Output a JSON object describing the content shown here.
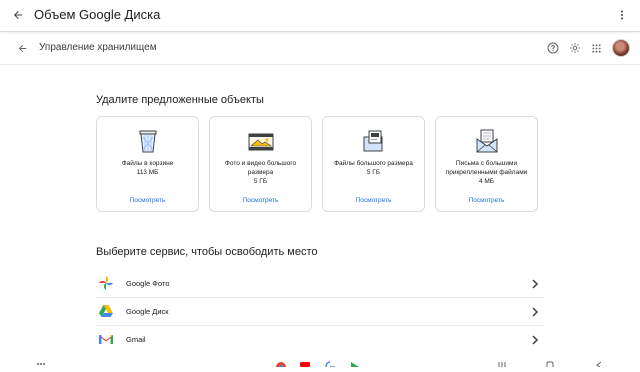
{
  "appbar": {
    "title": "Объем Google Диска"
  },
  "header": {
    "title": "Управление хранилищем"
  },
  "suggestions": {
    "title": "Удалите предложенные объекты",
    "cards": [
      {
        "label": "Файлы в корзине\n113 МБ",
        "action": "Посмотреть",
        "icon": "trash-icon"
      },
      {
        "label": "Фото и видео большого размера\n5 ГБ",
        "action": "Посмотреть",
        "icon": "photo-film-icon"
      },
      {
        "label": "Файлы большого размера\n5 ГБ",
        "action": "Посмотреть",
        "icon": "large-files-icon"
      },
      {
        "label": "Письма с большими прикрепленными файлами\n4 МБ",
        "action": "Посмотреть",
        "icon": "mail-attachment-icon"
      }
    ]
  },
  "services": {
    "title": "Выберите сервис, чтобы освободить место",
    "items": [
      {
        "name": "Google Фото",
        "icon": "google-photos-icon"
      },
      {
        "name": "Google Диск",
        "icon": "google-drive-icon"
      },
      {
        "name": "Gmail",
        "icon": "gmail-icon"
      }
    ]
  },
  "colors": {
    "accent": "#1a73e8",
    "text": "#202124",
    "border": "#dadce0"
  }
}
